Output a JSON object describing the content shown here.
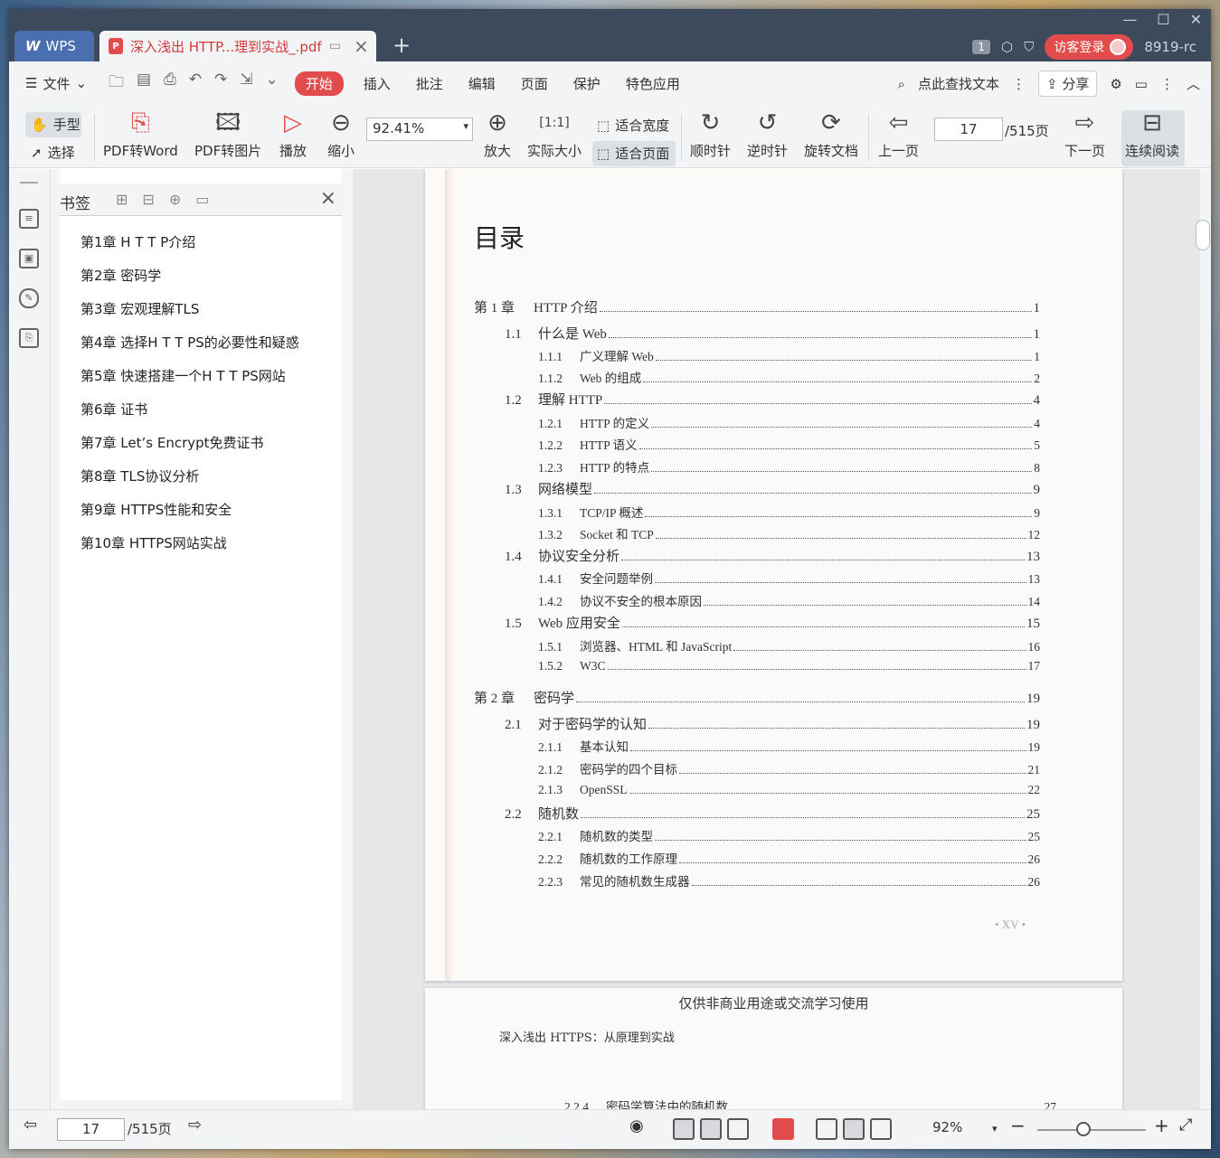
{
  "window": {
    "app_tab": "WPS",
    "doc_tab": "深入浅出 HTTP...理到实战_.pdf",
    "badge": "1",
    "login": "访客登录",
    "user": "8919-rc"
  },
  "menu": {
    "file": "文件",
    "items": [
      "开始",
      "插入",
      "批注",
      "编辑",
      "页面",
      "保护",
      "特色应用"
    ],
    "search": "点此查找文本",
    "share": "分享"
  },
  "toolbar": {
    "hand": "手型",
    "select": "选择",
    "pdf_word": "PDF转Word",
    "pdf_image": "PDF转图片",
    "play": "播放",
    "zoom_out": "缩小",
    "zoom_value": "92.41%",
    "zoom_in": "放大",
    "actual": "实际大小",
    "fit_width": "适合宽度",
    "fit_page": "适合页面",
    "cw": "顺时针",
    "ccw": "逆时针",
    "rotate": "旋转文档",
    "prev": "上一页",
    "page": "17",
    "total": "/515页",
    "next": "下一页",
    "continuous": "连续阅读"
  },
  "bookmarks": {
    "title": "书签",
    "items": [
      "第1章 H T T P介绍",
      "第2章 密码学",
      "第3章 宏观理解TLS",
      "第4章 选择H T T PS的必要性和疑惑",
      "第5章 快速搭建一个H T T PS网站",
      "第6章 证书",
      "第7章 Let’s Encrypt免费证书",
      "第8章 TLS协议分析",
      "第9章 HTTPS性能和安全",
      "第10章 HTTPS网站实战"
    ]
  },
  "toc": {
    "title": "目录",
    "entries": [
      {
        "num": "第 1 章",
        "text": "HTTP 介绍",
        "page": "1"
      },
      {
        "num": "1.1",
        "text": "什么是 Web",
        "page": "1"
      },
      {
        "num": "1.1.1",
        "text": "广义理解 Web",
        "page": "1"
      },
      {
        "num": "1.1.2",
        "text": "Web 的组成",
        "page": "2"
      },
      {
        "num": "1.2",
        "text": "理解 HTTP",
        "page": "4"
      },
      {
        "num": "1.2.1",
        "text": "HTTP 的定义",
        "page": "4"
      },
      {
        "num": "1.2.2",
        "text": "HTTP 语义",
        "page": "5"
      },
      {
        "num": "1.2.3",
        "text": "HTTP 的特点",
        "page": "8"
      },
      {
        "num": "1.3",
        "text": "网络模型",
        "page": "9"
      },
      {
        "num": "1.3.1",
        "text": "TCP/IP 概述",
        "page": "9"
      },
      {
        "num": "1.3.2",
        "text": "Socket 和 TCP",
        "page": "12"
      },
      {
        "num": "1.4",
        "text": "协议安全分析",
        "page": "13"
      },
      {
        "num": "1.4.1",
        "text": "安全问题举例",
        "page": "13"
      },
      {
        "num": "1.4.2",
        "text": "协议不安全的根本原因",
        "page": "14"
      },
      {
        "num": "1.5",
        "text": "Web 应用安全",
        "page": "15"
      },
      {
        "num": "1.5.1",
        "text": "浏览器、HTML 和 JavaScript",
        "page": "16"
      },
      {
        "num": "1.5.2",
        "text": "W3C",
        "page": "17"
      },
      {
        "num": "第 2 章",
        "text": "密码学",
        "page": "19"
      },
      {
        "num": "2.1",
        "text": "对于密码学的认知",
        "page": "19"
      },
      {
        "num": "2.1.1",
        "text": "基本认知",
        "page": "19"
      },
      {
        "num": "2.1.2",
        "text": "密码学的四个目标",
        "page": "21"
      },
      {
        "num": "2.1.3",
        "text": "OpenSSL",
        "page": "22"
      },
      {
        "num": "2.2",
        "text": "随机数",
        "page": "25"
      },
      {
        "num": "2.2.1",
        "text": "随机数的类型",
        "page": "25"
      },
      {
        "num": "2.2.2",
        "text": "随机数的工作原理",
        "page": "26"
      },
      {
        "num": "2.2.3",
        "text": "常见的随机数生成器",
        "page": "26"
      }
    ],
    "footer": "• XV •"
  },
  "page2": {
    "notice": "仅供非商业用途或交流学习使用",
    "header": "深入浅出 HTTPS：从原理到实战",
    "entry": {
      "num": "2.2.4",
      "text": "密码学算法中的随机数",
      "page": "27"
    }
  },
  "status": {
    "page": "17",
    "total": "/515页",
    "zoom": "92%"
  }
}
